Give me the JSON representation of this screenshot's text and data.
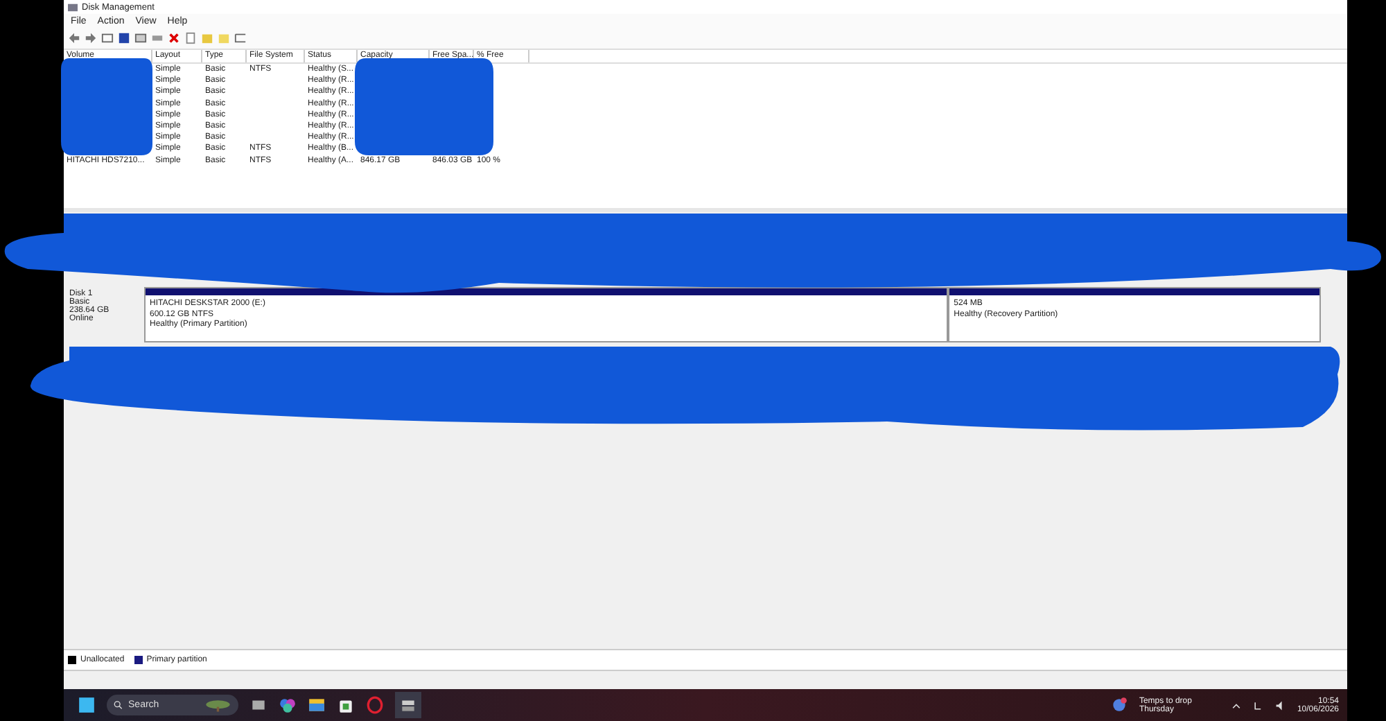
{
  "window": {
    "title": "Disk Management"
  },
  "menu": [
    "File",
    "Action",
    "View",
    "Help"
  ],
  "table": {
    "columns": [
      "Volume",
      "Layout",
      "Type",
      "File System",
      "Status",
      "Capacity",
      "Free Spa...",
      "% Free"
    ],
    "rows": [
      {
        "layout": "Simple",
        "type": "Basic",
        "file_system": "NTFS",
        "status": "Healthy (S..."
      },
      {
        "layout": "Simple",
        "type": "Basic",
        "status": "Healthy (R..."
      },
      {
        "layout": "Simple",
        "type": "Basic",
        "status": "Healthy (R..."
      },
      {
        "layout": "Simple",
        "type": "Basic",
        "status": "Healthy (R..."
      },
      {
        "layout": "Simple",
        "type": "Basic",
        "status": "Healthy (R..."
      },
      {
        "layout": "Simple",
        "type": "Basic",
        "status": "Healthy (R..."
      },
      {
        "layout": "Simple",
        "type": "Basic",
        "status": "Healthy (R..."
      },
      {
        "layout": "Simple",
        "type": "Basic",
        "file_system": "NTFS",
        "status": "Healthy (B..."
      },
      {
        "volume": "HITACHI HDS7210...",
        "layout": "Simple",
        "type": "Basic",
        "file_system": "NTFS",
        "status": "Healthy (A...",
        "capacity": "846.17 GB",
        "free": "846.03 GB",
        "percent_free": "100 %"
      }
    ]
  },
  "disk": {
    "name": "Disk 1",
    "type": "Basic",
    "size": "238.64 GB",
    "state": "Online",
    "partitions": [
      {
        "lines": [
          "HITACHI DESKSTAR 2000 (E:)",
          "600.12 GB NTFS",
          "Healthy (Primary Partition)"
        ]
      },
      {
        "lines": [
          "524 MB",
          "Healthy (Recovery Partition)"
        ]
      }
    ]
  },
  "legend": [
    {
      "label": "Unallocated",
      "color": "#000000"
    },
    {
      "label": "Primary partition",
      "color": "#1a1a80"
    }
  ],
  "taskbar": {
    "search": {
      "placeholder": "Search"
    },
    "weather": [
      "Temps to drop",
      "Thursday"
    ],
    "time": "10:54",
    "date": "10/06/2026"
  }
}
